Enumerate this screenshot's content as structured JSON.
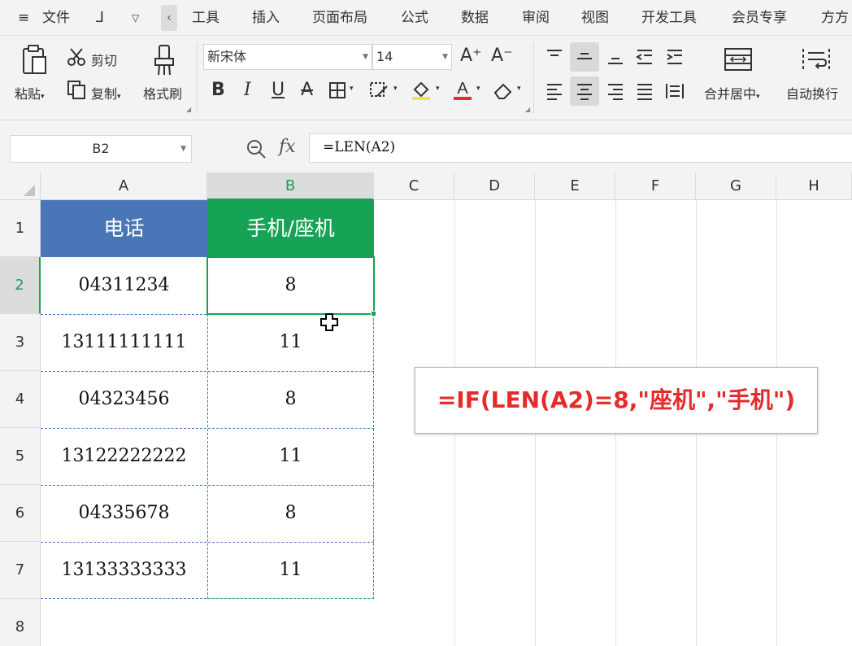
{
  "menubar": {
    "menu_icon": "hamburger-icon",
    "file": "文件",
    "tabs": [
      "工具",
      "插入",
      "页面布局",
      "公式",
      "数据",
      "审阅",
      "视图",
      "开发工具",
      "会员专享",
      "方方"
    ]
  },
  "ribbon": {
    "paste": "粘贴",
    "cut": "剪切",
    "copy": "复制",
    "format_painter": "格式刷",
    "font_name": "新宋体",
    "font_size": "14",
    "merge_center": "合并居中",
    "wrap_text": "自动换行"
  },
  "formula_bar": {
    "name_box": "B2",
    "fx": "fx",
    "formula": "=LEN(A2)"
  },
  "sheet": {
    "columns": [
      "A",
      "B",
      "C",
      "D",
      "E",
      "F",
      "G",
      "H"
    ],
    "rows": [
      "1",
      "2",
      "3",
      "4",
      "5",
      "6",
      "7",
      "8"
    ],
    "header_a": "电话",
    "header_b": "手机/座机",
    "header_a_color": "#4a76b8",
    "header_b_color": "#17a356",
    "data": [
      {
        "a": "04311234",
        "b": "8"
      },
      {
        "a": "13111111111",
        "b": "11"
      },
      {
        "a": "04323456",
        "b": "8"
      },
      {
        "a": "13122222222",
        "b": "11"
      },
      {
        "a": "04335678",
        "b": "8"
      },
      {
        "a": "13133333333",
        "b": "11"
      }
    ]
  },
  "callout": {
    "text": "=IF(LEN(A2)=8,\"座机\",\"手机\")",
    "color": "#e52b2b"
  }
}
